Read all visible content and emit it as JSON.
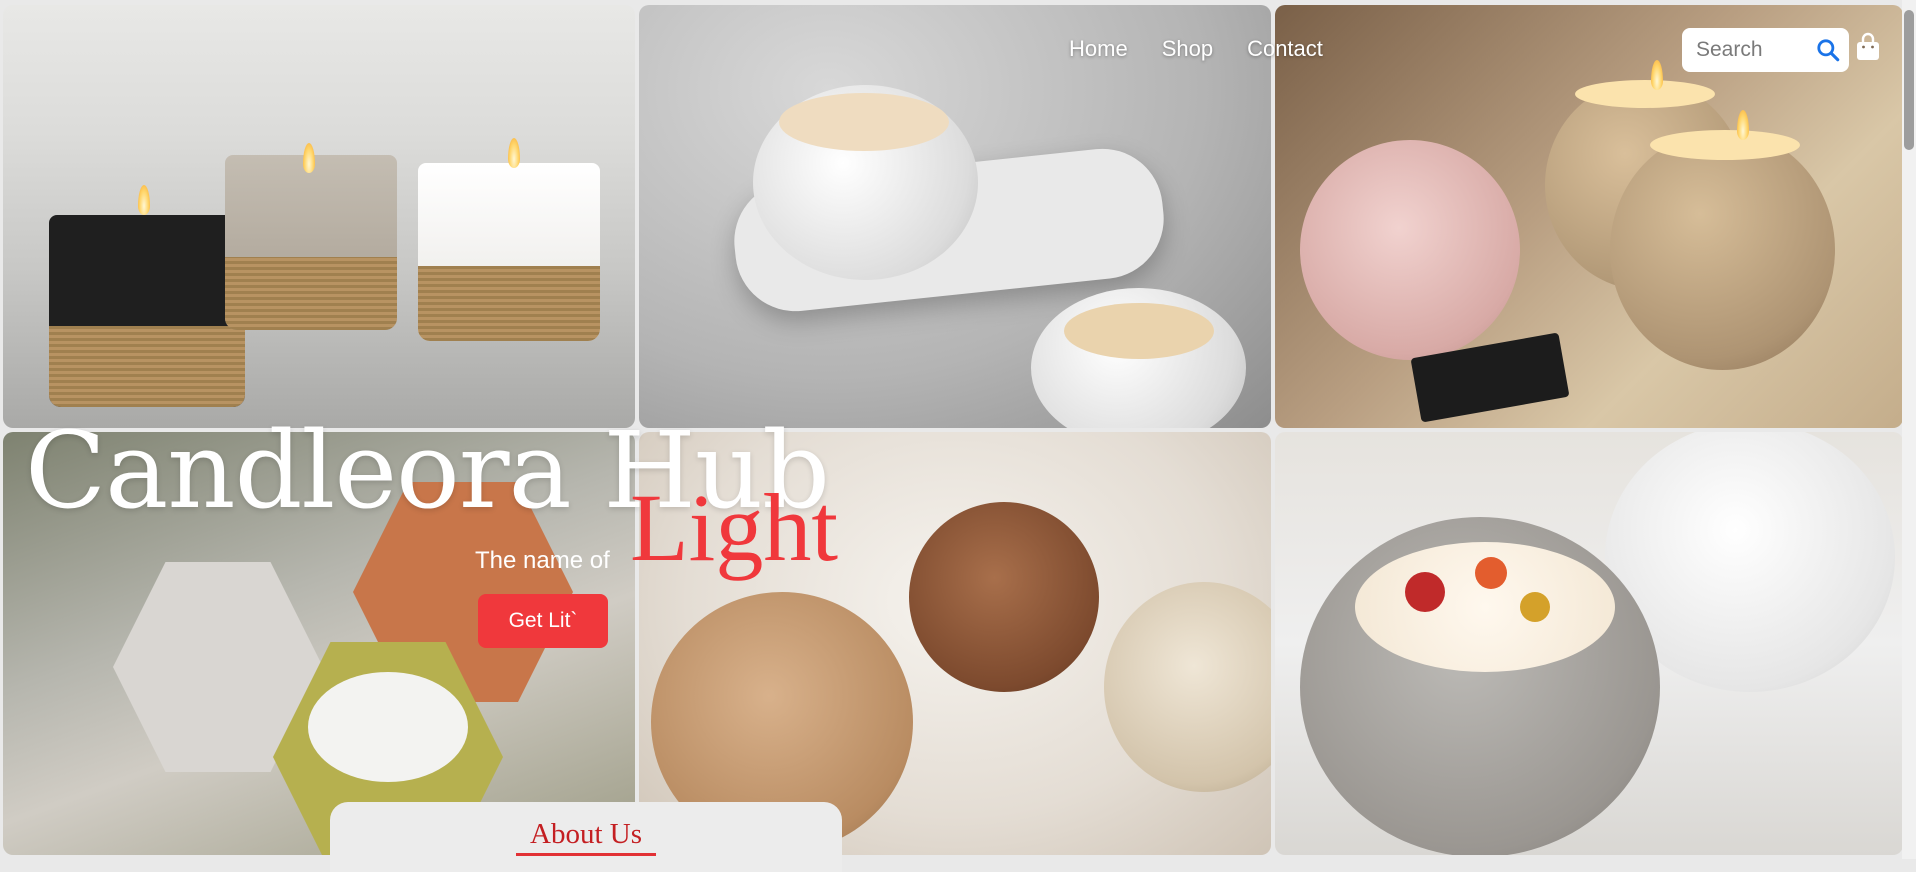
{
  "nav": {
    "items": [
      "Home",
      "Shop",
      "Contact"
    ]
  },
  "search": {
    "placeholder": "Search"
  },
  "icons": {
    "search": "search-icon",
    "cart": "shopping-bag-icon"
  },
  "hero": {
    "title": "Candleora Hub",
    "subtitle": "The name of",
    "highlight": "Light",
    "cta_label": "Get Lit`"
  },
  "about": {
    "title": "About Us"
  },
  "colors": {
    "accent": "#f0383c",
    "search_icon": "#1a73e8",
    "text_light": "#ffffff"
  }
}
